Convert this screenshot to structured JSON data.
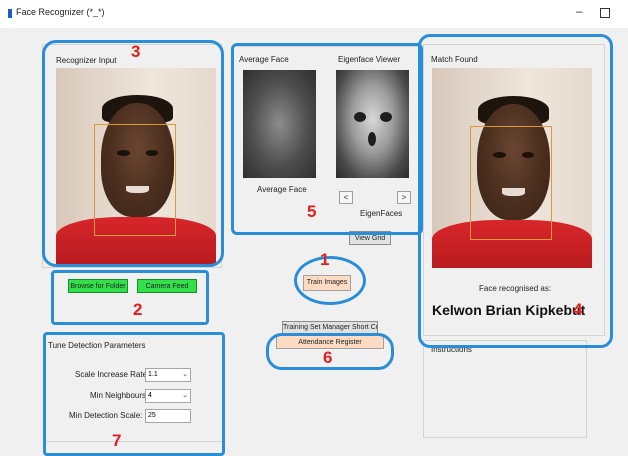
{
  "window": {
    "title": "Face Recognizer (*_*)",
    "minimize": "–"
  },
  "recognizer": {
    "title": "Recognizer Input"
  },
  "buttons": {
    "browse": "Browse for Folder",
    "camera": "Camera Feed",
    "train": "Train Images",
    "view_grid": "View Grid",
    "training_shortcut": "Training Set Manager Short Cut",
    "attendance": "Attendance Register"
  },
  "eigen": {
    "average_title": "Average Face",
    "viewer_title": "Eigenface Viewer",
    "average_caption": "Average Face",
    "eigen_caption": "EigenFaces",
    "prev": "<",
    "next": ">"
  },
  "match": {
    "title": "Match Found",
    "recognised_label": "Face recognised as:",
    "name": "Kelwon Brian Kipkebut"
  },
  "instructions": {
    "title": "Instructions"
  },
  "detection": {
    "title": "Tune Detection Parameters",
    "scale_label": "Scale Increase Rate:",
    "scale_value": "1.1",
    "neighbours_label": "Min Neighbours:",
    "neighbours_value": "4",
    "min_scale_label": "Min Detection Scale:",
    "min_scale_value": "25"
  },
  "annotations": [
    "1",
    "2",
    "3",
    "4",
    "5",
    "6",
    "7"
  ],
  "colors": {
    "highlight": "#2a8dd8",
    "annotation": "#e02020",
    "green_button": "#31e04a",
    "peach_button": "#fddbc2"
  }
}
